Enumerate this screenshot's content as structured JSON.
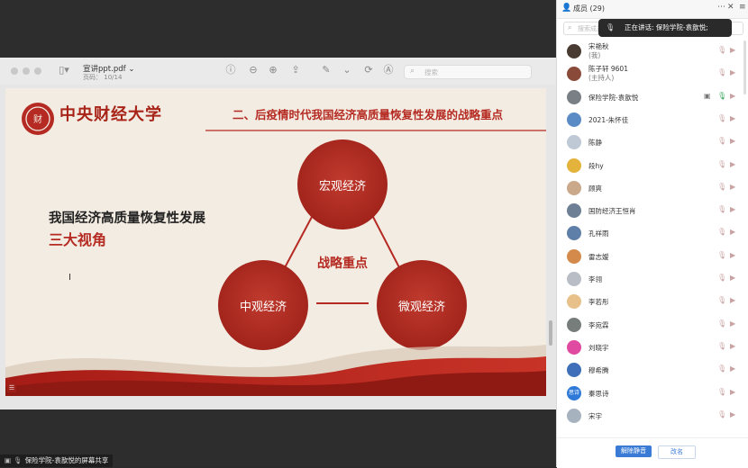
{
  "pdf": {
    "file_title": "宣讲ppt.pdf",
    "page_label": "页码：",
    "page_value": "10/14",
    "search_placeholder": "搜索"
  },
  "slide": {
    "logo_text": "中央财经大学",
    "heading": "二、后疫情时代我国经济高质量恢复性发展的战略重点",
    "left_title_line1": "我国经济高质量恢复性发展",
    "left_title_line2": "三大视角",
    "circle_top": "宏观经济",
    "circle_left": "中观经济",
    "circle_right": "微观经济",
    "center_label": "战略重点",
    "colors": {
      "red": "#b52a22",
      "dark_red": "#9e2119",
      "bg": "#f3ece2"
    }
  },
  "screen_share": {
    "label": "保险学院-袁歆悦的屏幕共享"
  },
  "panel": {
    "title": "成员 (29)",
    "search_placeholder": "搜索成员",
    "speaking_text": "正在讲话: 保险学院-袁歆悦;",
    "members": [
      {
        "name": "宋艳秋",
        "sub": "(我)",
        "color": "#4a3b32"
      },
      {
        "name": "陈子轩 9601",
        "sub": "(主持人)",
        "color": "#8a4a3a"
      },
      {
        "name": "保险学院-袁歆悦",
        "sub": "",
        "color": "#7a7f86",
        "sharing": true
      },
      {
        "name": "2021-朱怀佳",
        "sub": "",
        "color": "#5b8bc4"
      },
      {
        "name": "陈静",
        "sub": "",
        "color": "#bfc9d6"
      },
      {
        "name": "段hy",
        "sub": "",
        "color": "#e3b33b"
      },
      {
        "name": "顾爽",
        "sub": "",
        "color": "#c9a98a"
      },
      {
        "name": "国防经济王恒肖",
        "sub": "",
        "color": "#6c7f95"
      },
      {
        "name": "孔祥雨",
        "sub": "",
        "color": "#5e7fa8"
      },
      {
        "name": "雷志嫒",
        "sub": "",
        "color": "#d48a4a"
      },
      {
        "name": "李翎",
        "sub": "",
        "color": "#b9bec6"
      },
      {
        "name": "李若彤",
        "sub": "",
        "color": "#e8c08a"
      },
      {
        "name": "李宛霖",
        "sub": "",
        "color": "#777d7a"
      },
      {
        "name": "刘晓宇",
        "sub": "",
        "color": "#e04aa0"
      },
      {
        "name": "穆希腾",
        "sub": "",
        "color": "#3e6fb8"
      },
      {
        "name": "秦思诗",
        "sub": "",
        "color": "#2f79d8",
        "initials": "思诗"
      },
      {
        "name": "宋宇",
        "sub": "",
        "color": "#a7b2bf"
      }
    ],
    "unmute_label": "解除静音",
    "rename_label": "改名"
  }
}
